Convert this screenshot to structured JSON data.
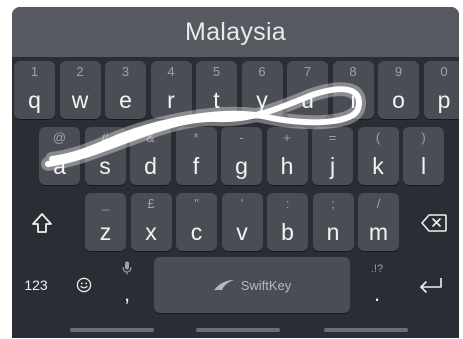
{
  "prediction_bar": {
    "word": "Malaysia"
  },
  "rows": [
    [
      {
        "hint": "1",
        "label": "q"
      },
      {
        "hint": "2",
        "label": "w"
      },
      {
        "hint": "3",
        "label": "e"
      },
      {
        "hint": "4",
        "label": "r"
      },
      {
        "hint": "5",
        "label": "t"
      },
      {
        "hint": "6",
        "label": "y"
      },
      {
        "hint": "7",
        "label": "u"
      },
      {
        "hint": "8",
        "label": "i"
      },
      {
        "hint": "9",
        "label": "o"
      },
      {
        "hint": "0",
        "label": "p"
      }
    ],
    [
      {
        "hint": "@",
        "label": "a"
      },
      {
        "hint": "#",
        "label": "s"
      },
      {
        "hint": "&",
        "label": "d"
      },
      {
        "hint": "*",
        "label": "f"
      },
      {
        "hint": "-",
        "label": "g"
      },
      {
        "hint": "+",
        "label": "h"
      },
      {
        "hint": "=",
        "label": "j"
      },
      {
        "hint": "(",
        "label": "k"
      },
      {
        "hint": ")",
        "label": "l"
      }
    ],
    [
      {
        "hint": "_",
        "label": "z"
      },
      {
        "hint": "£",
        "label": "x"
      },
      {
        "hint": "\"",
        "label": "c"
      },
      {
        "hint": "'",
        "label": "v"
      },
      {
        "hint": ":",
        "label": "b"
      },
      {
        "hint": ";",
        "label": "n"
      },
      {
        "hint": "/",
        "label": "m"
      }
    ]
  ],
  "function_keys": {
    "shift_icon": "shift-icon",
    "backspace_icon": "backspace-icon",
    "numbers_label": "123",
    "emoji_icon": "emoji-icon",
    "mic_icon": "microphone-icon",
    "comma_label": ",",
    "space_logo_icon": "swiftkey-logo-icon",
    "space_label": "SwiftKey",
    "period_hint": ".!?",
    "period_label": ".",
    "enter_icon": "enter-icon"
  },
  "colors": {
    "keyboard_bg": "#2a2d33",
    "key_bg": "#4a4d53",
    "prediction_bg": "#565a60",
    "trail": "#ffffff"
  }
}
